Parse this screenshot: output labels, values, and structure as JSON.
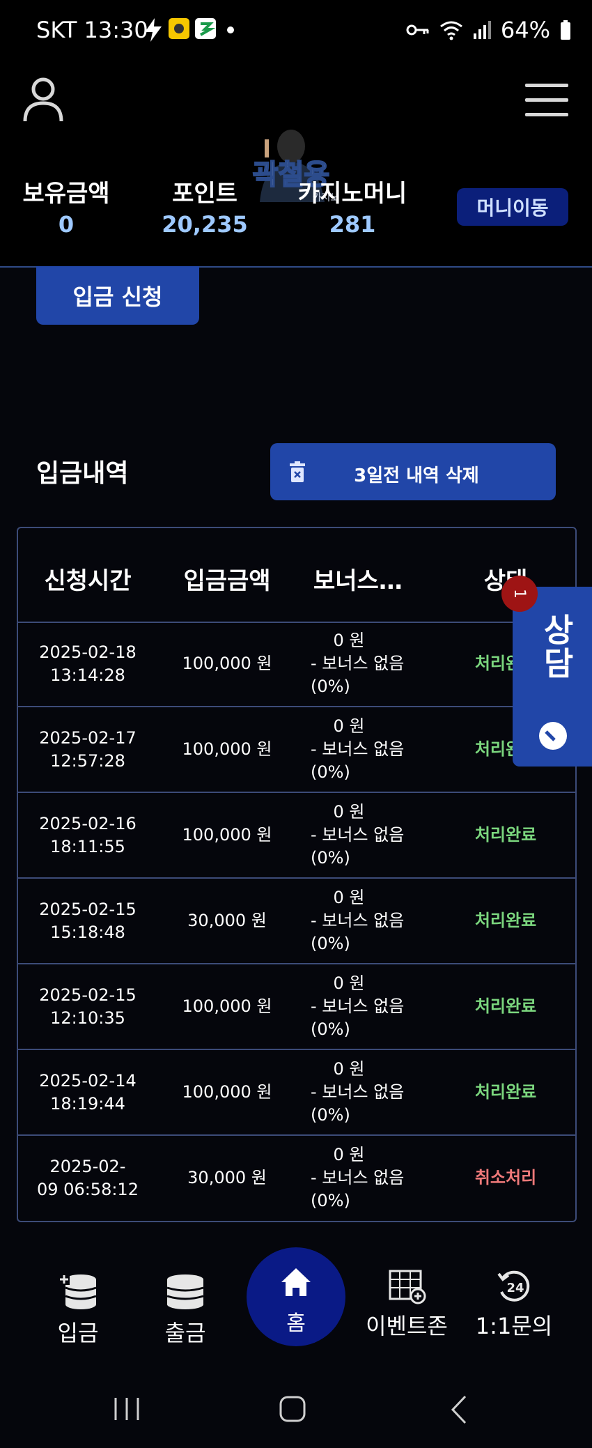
{
  "status_bar": {
    "carrier_time": "SKT 13:30",
    "battery": "64%"
  },
  "header": {
    "logo_text": "곽철용",
    "logo_sub": "카지노"
  },
  "balances": {
    "holding_label": "보유금액",
    "holding_value": "0",
    "point_label": "포인트",
    "point_value": "20,235",
    "casino_label": "카지노머니",
    "casino_value": "281",
    "move_button": "머니이동"
  },
  "deposit_button": "입금 신청",
  "history": {
    "title": "입금내역",
    "delete_button": "3일전 내역 삭제",
    "columns": [
      "신청시간",
      "입금금액",
      "보너스…",
      "상태"
    ],
    "rows": [
      {
        "time1": "2025-02-18",
        "time2": "13:14:28",
        "amount": "100,000 원",
        "bonus1": "0 원",
        "bonus2": "- 보너스 없음",
        "bonus3": "(0%)",
        "status": "처리완료"
      },
      {
        "time1": "2025-02-17",
        "time2": "12:57:28",
        "amount": "100,000 원",
        "bonus1": "0 원",
        "bonus2": "- 보너스 없음",
        "bonus3": "(0%)",
        "status": "처리완료"
      },
      {
        "time1": "2025-02-16",
        "time2": "18:11:55",
        "amount": "100,000 원",
        "bonus1": "0 원",
        "bonus2": "- 보너스 없음",
        "bonus3": "(0%)",
        "status": "처리완료"
      },
      {
        "time1": "2025-02-15",
        "time2": "15:18:48",
        "amount": "30,000 원",
        "bonus1": "0 원",
        "bonus2": "- 보너스 없음",
        "bonus3": "(0%)",
        "status": "처리완료"
      },
      {
        "time1": "2025-02-15",
        "time2": "12:10:35",
        "amount": "100,000 원",
        "bonus1": "0 원",
        "bonus2": "- 보너스 없음",
        "bonus3": "(0%)",
        "status": "처리완료"
      },
      {
        "time1": "2025-02-14",
        "time2": "18:19:44",
        "amount": "100,000 원",
        "bonus1": "0 원",
        "bonus2": "- 보너스 없음",
        "bonus3": "(0%)",
        "status": "처리완료"
      },
      {
        "time1": "2025-02-",
        "time2": "09 06:58:12",
        "amount": "30,000 원",
        "bonus1": "0 원",
        "bonus2": "- 보너스 없음",
        "bonus3": "(0%)",
        "status": "취소처리"
      }
    ]
  },
  "consult_tab": {
    "label": "상담",
    "badge": "1"
  },
  "bottom_nav": {
    "deposit": "입금",
    "withdraw": "출금",
    "home": "홈",
    "event": "이벤트존",
    "inquiry": "1:1문의"
  },
  "colors": {
    "accent_blue": "#2146a8",
    "status_done": "#7bd67e",
    "status_cancel": "#f07a7a",
    "value_blue": "#9ec9ff"
  }
}
